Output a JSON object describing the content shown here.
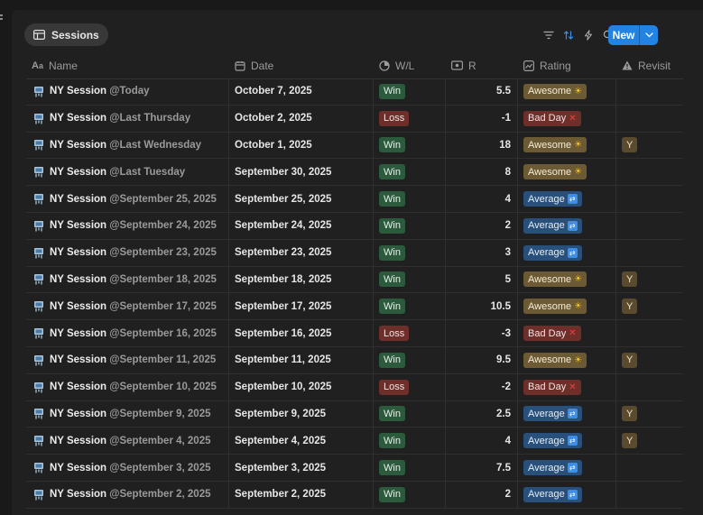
{
  "view": {
    "tab_label": "Sessions"
  },
  "toolbar": {
    "new_label": "New"
  },
  "columns": {
    "name": "Name",
    "date": "Date",
    "wl": "W/L",
    "r": "R",
    "rating": "Rating",
    "revisit": "Revisit"
  },
  "colors": {
    "accent": "#2383e2",
    "win": "#2b5a3c",
    "loss": "#6e2f2b",
    "awesome": "#6b5a33",
    "average": "#28507a",
    "revisit": "#5a4a2e"
  },
  "rows": [
    {
      "title": "NY Session",
      "mention": "@Today",
      "date": "October 7, 2025",
      "wl": "Win",
      "r": "5.5",
      "rating": "Awesome",
      "revisit": ""
    },
    {
      "title": "NY Session",
      "mention": "@Last Thursday",
      "date": "October 2, 2025",
      "wl": "Loss",
      "r": "-1",
      "rating": "Bad Day",
      "revisit": ""
    },
    {
      "title": "NY Session",
      "mention": "@Last Wednesday",
      "date": "October 1, 2025",
      "wl": "Win",
      "r": "18",
      "rating": "Awesome",
      "revisit": "Y"
    },
    {
      "title": "NY Session",
      "mention": "@Last Tuesday",
      "date": "September 30, 2025",
      "wl": "Win",
      "r": "8",
      "rating": "Awesome",
      "revisit": ""
    },
    {
      "title": "NY Session",
      "mention": "@September 25, 2025",
      "date": "September 25, 2025",
      "wl": "Win",
      "r": "4",
      "rating": "Average",
      "revisit": ""
    },
    {
      "title": "NY Session",
      "mention": "@September 24, 2025",
      "date": "September 24, 2025",
      "wl": "Win",
      "r": "2",
      "rating": "Average",
      "revisit": ""
    },
    {
      "title": "NY Session",
      "mention": "@September 23, 2025",
      "date": "September 23, 2025",
      "wl": "Win",
      "r": "3",
      "rating": "Average",
      "revisit": ""
    },
    {
      "title": "NY Session",
      "mention": "@September 18, 2025",
      "date": "September 18, 2025",
      "wl": "Win",
      "r": "5",
      "rating": "Awesome",
      "revisit": "Y"
    },
    {
      "title": "NY Session",
      "mention": "@September 17, 2025",
      "date": "September 17, 2025",
      "wl": "Win",
      "r": "10.5",
      "rating": "Awesome",
      "revisit": "Y"
    },
    {
      "title": "NY Session",
      "mention": "@September 16, 2025",
      "date": "September 16, 2025",
      "wl": "Loss",
      "r": "-3",
      "rating": "Bad Day",
      "revisit": ""
    },
    {
      "title": "NY Session",
      "mention": "@September 11, 2025",
      "date": "September 11, 2025",
      "wl": "Win",
      "r": "9.5",
      "rating": "Awesome",
      "revisit": "Y"
    },
    {
      "title": "NY Session",
      "mention": "@September 10, 2025",
      "date": "September 10, 2025",
      "wl": "Loss",
      "r": "-2",
      "rating": "Bad Day",
      "revisit": ""
    },
    {
      "title": "NY Session",
      "mention": "@September 9, 2025",
      "date": "September 9, 2025",
      "wl": "Win",
      "r": "2.5",
      "rating": "Average",
      "revisit": "Y"
    },
    {
      "title": "NY Session",
      "mention": "@September 4, 2025",
      "date": "September 4, 2025",
      "wl": "Win",
      "r": "4",
      "rating": "Average",
      "revisit": "Y"
    },
    {
      "title": "NY Session",
      "mention": "@September 3, 2025",
      "date": "September 3, 2025",
      "wl": "Win",
      "r": "7.5",
      "rating": "Average",
      "revisit": ""
    },
    {
      "title": "NY Session",
      "mention": "@September 2, 2025",
      "date": "September 2, 2025",
      "wl": "Win",
      "r": "2",
      "rating": "Average",
      "revisit": ""
    }
  ]
}
